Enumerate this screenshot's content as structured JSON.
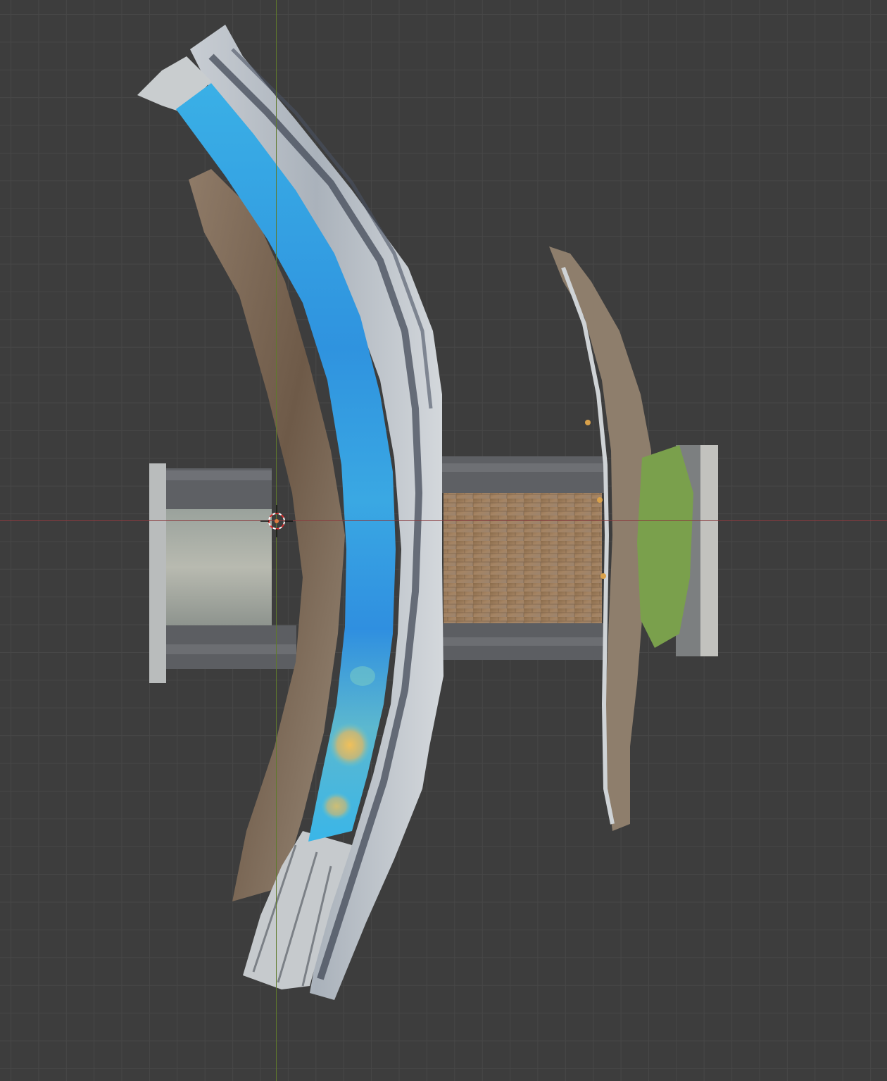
{
  "viewport": {
    "view": "top-orthographic",
    "background_color": "#3d3d3d",
    "grid_color": "#474747",
    "x_axis_color": "#8a3a3e",
    "y_axis_color": "#5f7a2c"
  },
  "scene": {
    "objects": [
      {
        "name": "curved-path-mesh",
        "texture": "photogrammetry-stone-path-with-railing"
      },
      {
        "name": "flow-heatmap-overlay",
        "colormap": [
          "#2f8fe0",
          "#3ab6e8",
          "#6cc7c8",
          "#e8c060"
        ]
      },
      {
        "name": "west-bridge-block",
        "texture": "stone-wall"
      },
      {
        "name": "east-bridge-block",
        "texture": "brick-wall"
      },
      {
        "name": "east-bank-strip",
        "texture": "vegetation-and-leaves"
      }
    ],
    "cursor_icon": "3d-cursor-icon"
  }
}
